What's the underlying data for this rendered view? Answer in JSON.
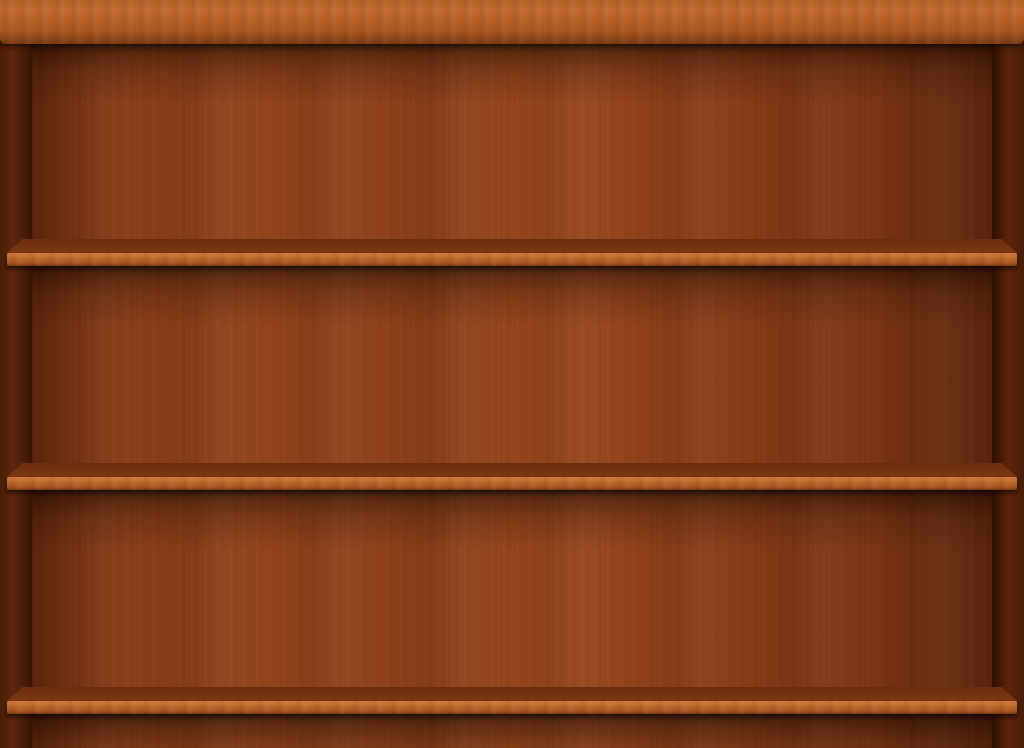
{
  "app": {
    "name": "",
    "shelves": [
      {
        "books": []
      },
      {
        "books": []
      },
      {
        "books": []
      }
    ]
  },
  "colors": {
    "wood_light": "#c06b30",
    "wood_mid": "#94441a",
    "wood_dark": "#4a200c"
  }
}
